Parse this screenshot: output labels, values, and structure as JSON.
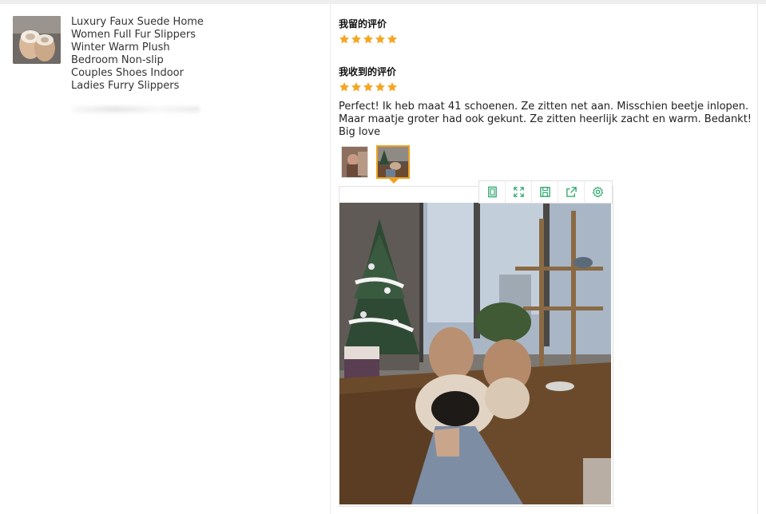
{
  "product": {
    "title_lines": [
      "Luxury Faux Suede Home",
      "Women Full Fur Slippers",
      "Winter Warm Plush",
      "Bedroom Non-slip",
      "Couples Shoes Indoor",
      "Ladies Furry Slippers"
    ],
    "thumbnail_icon": "slippers-photo"
  },
  "review": {
    "my_review_label": "我留的评价",
    "my_rating": 5,
    "received_review_label": "我收到的评价",
    "received_rating": 5,
    "text": "Perfect! Ik heb maat 41 schoenen. Ze zitten net aan. Misschien beetje inlopen. Maar maatje groter had ook gekunt. Ze zitten heerlijk zacht en warm. Bedankt! Big love",
    "images": [
      {
        "icon": "person-photo",
        "selected": false
      },
      {
        "icon": "slippers-on-table-photo",
        "selected": true
      }
    ]
  },
  "viewer": {
    "tools": [
      {
        "name": "original-size-icon"
      },
      {
        "name": "fullscreen-icon"
      },
      {
        "name": "save-icon"
      },
      {
        "name": "share-icon"
      },
      {
        "name": "settings-icon"
      }
    ]
  },
  "colors": {
    "star": "#f5a623",
    "accent": "#f0a020",
    "tool_icon": "#2aa56a"
  }
}
